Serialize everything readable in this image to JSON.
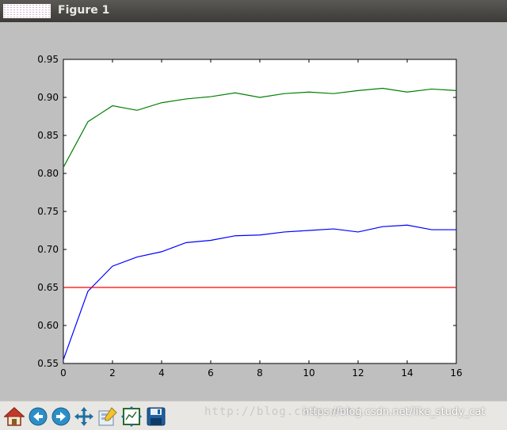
{
  "window": {
    "title": "Figure 1"
  },
  "toolbar": {
    "buttons": [
      {
        "name": "home-icon"
      },
      {
        "name": "back-icon"
      },
      {
        "name": "forward-icon"
      },
      {
        "name": "pan-icon"
      },
      {
        "name": "zoom-icon"
      },
      {
        "name": "configure-subplots-icon"
      },
      {
        "name": "save-icon"
      }
    ],
    "watermark": "http://blog.csdn.net/",
    "credit": "https://blog.csdn.net/like_study_cat"
  },
  "colors": {
    "green": "#008000",
    "blue": "#0000ff",
    "red": "#ff0000"
  },
  "chart_data": {
    "type": "line",
    "title": "",
    "xlabel": "",
    "ylabel": "",
    "xlim": [
      0,
      16
    ],
    "ylim": [
      0.55,
      0.95
    ],
    "xticks": [
      0,
      2,
      4,
      6,
      8,
      10,
      12,
      14,
      16
    ],
    "yticks": [
      0.55,
      0.6,
      0.65,
      0.7,
      0.75,
      0.8,
      0.85,
      0.9,
      0.95
    ],
    "x": [
      0,
      1,
      2,
      3,
      4,
      5,
      6,
      7,
      8,
      9,
      10,
      11,
      12,
      13,
      14,
      15,
      16
    ],
    "series": [
      {
        "color": "#008000",
        "values": [
          0.808,
          0.868,
          0.889,
          0.883,
          0.893,
          0.898,
          0.901,
          0.906,
          0.9,
          0.905,
          0.907,
          0.905,
          0.909,
          0.912,
          0.907,
          0.911,
          0.909
        ]
      },
      {
        "color": "#0000ff",
        "values": [
          0.555,
          0.645,
          0.678,
          0.69,
          0.697,
          0.709,
          0.712,
          0.718,
          0.719,
          0.723,
          0.725,
          0.727,
          0.723,
          0.73,
          0.732,
          0.726,
          0.726
        ]
      },
      {
        "color": "#ff0000",
        "values": [
          0.65,
          0.65,
          0.65,
          0.65,
          0.65,
          0.65,
          0.65,
          0.65,
          0.65,
          0.65,
          0.65,
          0.65,
          0.65,
          0.65,
          0.65,
          0.65,
          0.65
        ]
      }
    ]
  }
}
